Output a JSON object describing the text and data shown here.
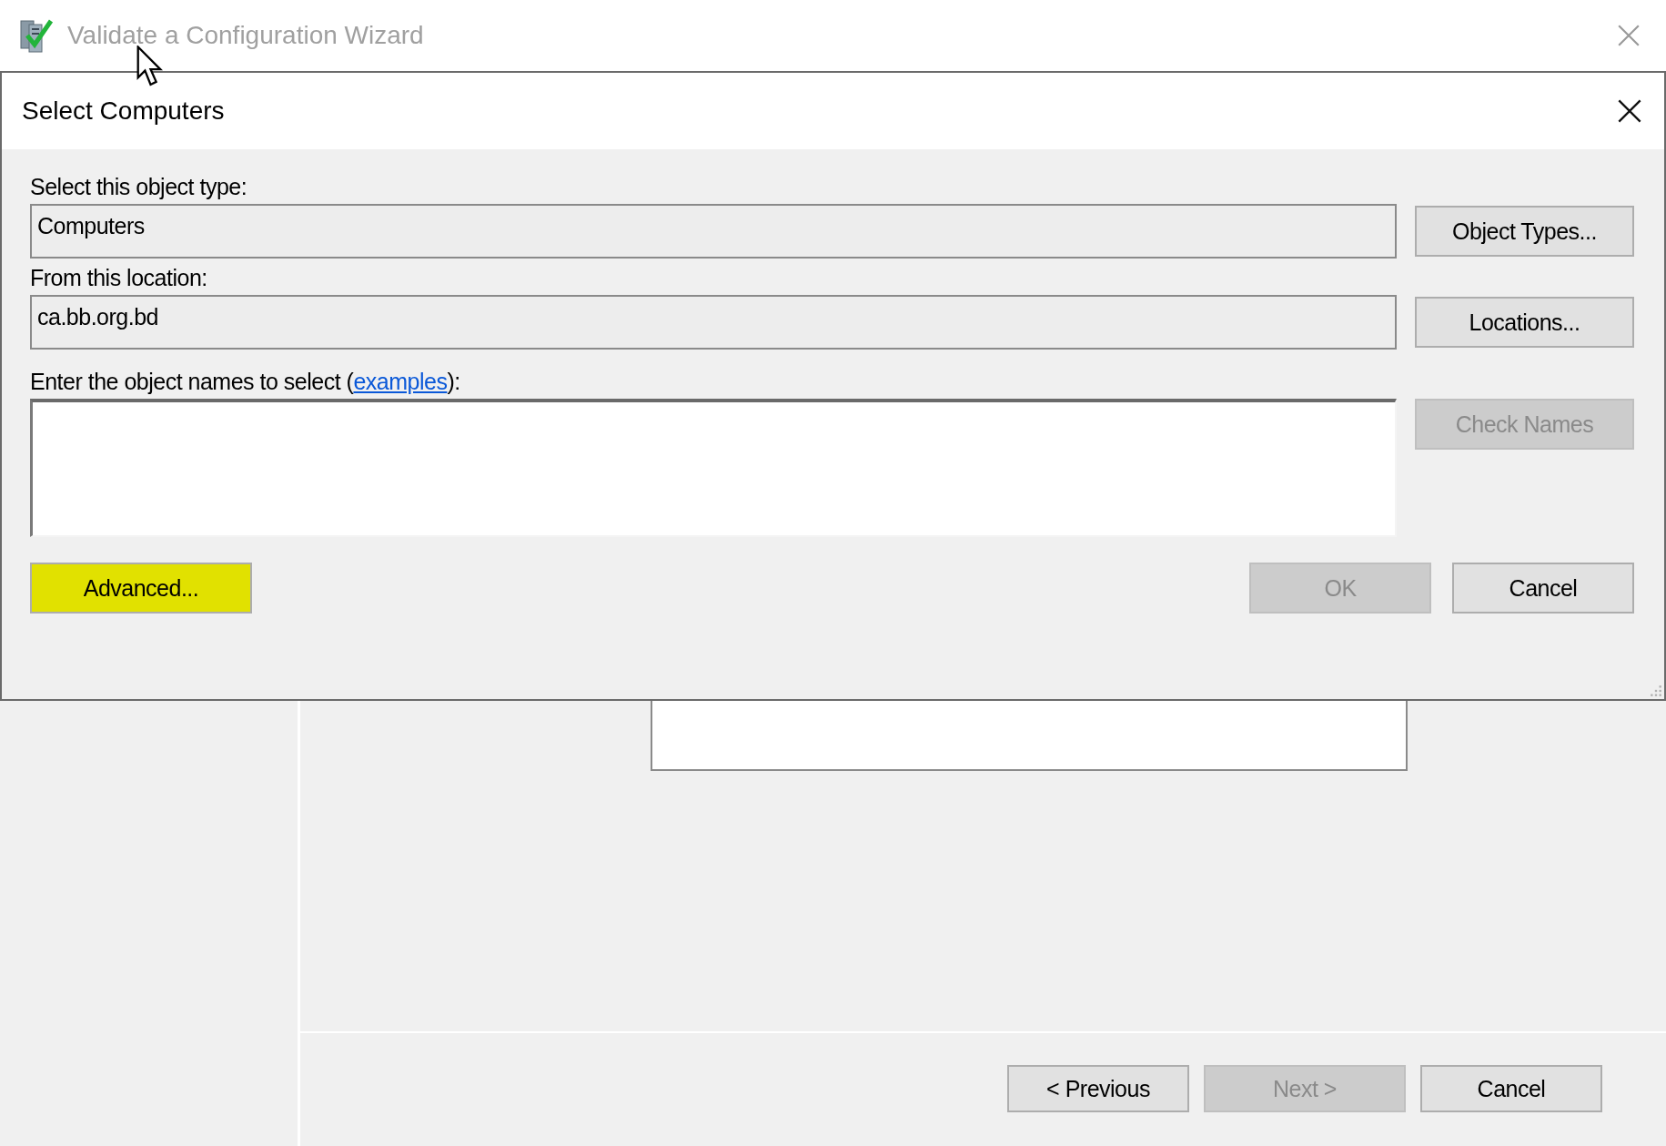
{
  "wizard": {
    "title": "Validate a Configuration Wizard",
    "buttons": [
      {
        "label": "< Previous",
        "disabled": false
      },
      {
        "label": "Next >",
        "disabled": true
      },
      {
        "label": "Cancel",
        "disabled": false
      }
    ]
  },
  "dialog": {
    "title": "Select Computers",
    "object_type": {
      "label": "Select this object type:",
      "value": "Computers",
      "button": {
        "label": "Object Types...",
        "disabled": false
      }
    },
    "location": {
      "label": "From this location:",
      "value": "ca.bb.org.bd",
      "button": {
        "label": "Locations...",
        "disabled": false
      }
    },
    "names": {
      "label_before": "Enter the object names to select (",
      "link": "examples",
      "label_after": "):",
      "button": {
        "label": "Check Names",
        "disabled": true
      }
    },
    "advanced_button": {
      "label": "Advanced...",
      "highlighted": true
    },
    "ok_button": {
      "label": "OK",
      "disabled": true
    },
    "cancel_button": {
      "label": "Cancel",
      "disabled": false
    }
  }
}
